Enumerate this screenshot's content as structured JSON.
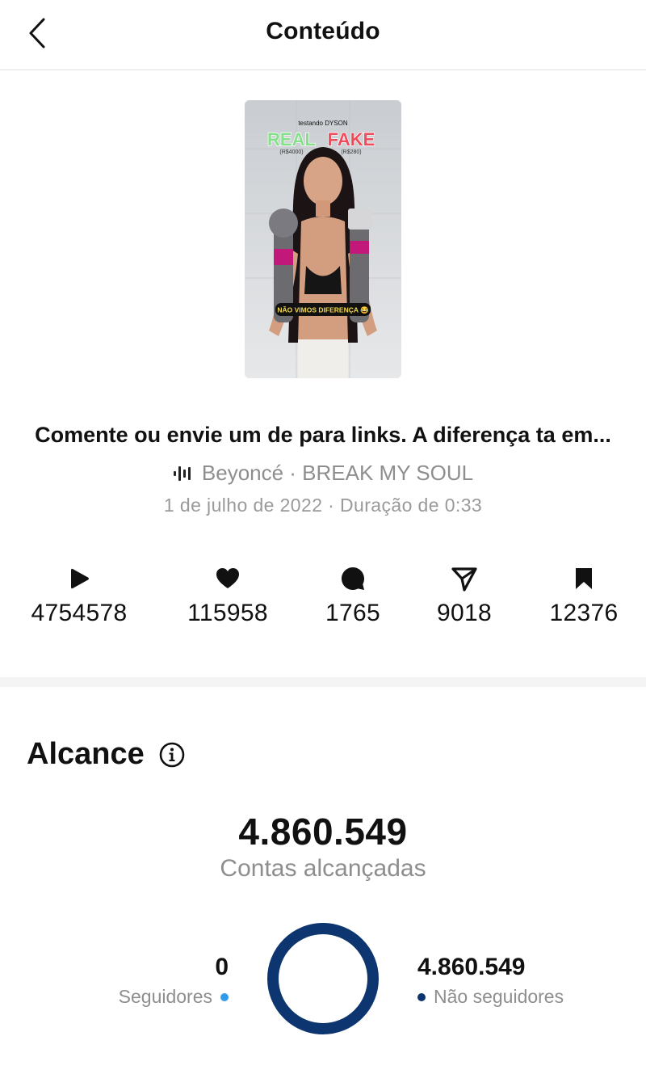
{
  "header": {
    "title": "Conteúdo",
    "back_icon": "chevron-left-icon"
  },
  "thumbnail": {
    "overlay_top": "testando DYSON",
    "overlay_real": "REAL",
    "overlay_real_price": "(R$4000)",
    "overlay_fake": "FAKE",
    "overlay_fake_price": "(R$280)",
    "overlay_bottom": "NÃO VIMOS DIFERENÇA 😂"
  },
  "post": {
    "caption": "Comente ou envie um de para links. A diferença ta em...",
    "audio": "Beyoncé · BREAK MY SOUL",
    "audio_icon": "audio-waveform-icon",
    "meta": "1 de julho de 2022 · Duração de 0:33"
  },
  "stats": [
    {
      "icon": "play-icon",
      "value": "4754578"
    },
    {
      "icon": "heart-icon",
      "value": "115958"
    },
    {
      "icon": "comment-icon",
      "value": "1765"
    },
    {
      "icon": "share-icon",
      "value": "9018"
    },
    {
      "icon": "bookmark-icon",
      "value": "12376"
    }
  ],
  "reach": {
    "title": "Alcance",
    "info_icon": "info-icon",
    "total": "4.860.549",
    "total_label": "Contas alcançadas",
    "followers": {
      "value": "0",
      "label": "Seguidores",
      "color": "#2f9bea"
    },
    "non_followers": {
      "value": "4.860.549",
      "label": "Não seguidores",
      "color": "#0d3570"
    }
  },
  "chart_data": {
    "type": "pie",
    "categories": [
      "Seguidores",
      "Não seguidores"
    ],
    "values": [
      0,
      4860549
    ]
  }
}
